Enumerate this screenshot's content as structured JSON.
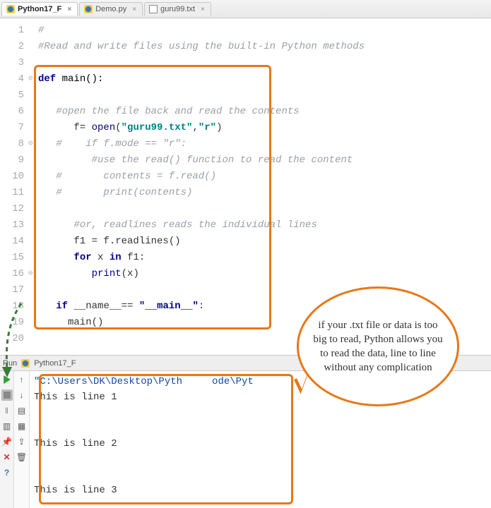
{
  "tabs": [
    {
      "label": "Python17_F",
      "kind": "py",
      "active": true
    },
    {
      "label": "Demo.py",
      "kind": "py",
      "active": false
    },
    {
      "label": "guru99.txt",
      "kind": "txt",
      "active": false
    }
  ],
  "code": {
    "lines": {
      "l1": "#",
      "l2": "#Read and write files using the built-in Python methods",
      "l3": "",
      "l4_def": "def",
      "l4_name": " main():",
      "l5": "",
      "l6": "   #open the file back and read the contents",
      "l7_pre": "      f= ",
      "l7_fn": "open",
      "l7_s1": "\"guru99.txt\"",
      "l7_c": ",",
      "l7_s2": "\"r\"",
      "l7_post": ")",
      "l8": "   #    if f.mode == \"r\":",
      "l9": "         #use the read() function to read the content",
      "l10": "   #       contents = f.read()",
      "l11": "   #       print(contents)",
      "l12": "",
      "l13": "      #or, readlines reads the individual lines",
      "l14": "      f1 = f.readlines()",
      "l15_pre": "      ",
      "l15_for": "for",
      "l15_mid": " x ",
      "l15_in": "in",
      "l15_post": " f1:",
      "l16_pre": "         ",
      "l16_fn": "print",
      "l16_post": "(x)",
      "l17": "",
      "l18_pre": "   ",
      "l18_if": "if",
      "l18_mid": " __name__== ",
      "l18_str": "\"__main__\"",
      "l18_post": ":",
      "l19": "     main()"
    },
    "gutter": "1\n2\n3\n4\n5\n6\n7\n8\n9\n10\n11\n12\n13\n14\n15\n16\n17\n18\n19\n20",
    "fold": "\n\n\n⊖\n\n\n\n⊖\n\n\n\n\n\n\n\n⊖\n\n\n\n"
  },
  "run": {
    "header_label": "Run",
    "config_name": "Python17_F",
    "path_line": "\"C:\\Users\\DK\\Desktop\\Pyth     ode\\Pyt",
    "out1": "This is line 1",
    "out2": "This is line 2",
    "out3": "This is line 3"
  },
  "callout": {
    "text": "if your .txt file or data is too big to read, Python allows you to read the data, line to line without any complication"
  },
  "icons": {
    "run_play": "run-icon",
    "run_stop": "stop-icon",
    "run_pause": "pause-icon",
    "run_restart": "restart-icon",
    "run_up": "up-icon",
    "run_down": "down-icon",
    "run_settings": "settings-icon",
    "run_layout": "layout-icon",
    "run_pin": "pin-icon",
    "run_trash": "trash-icon",
    "run_close": "close-icon",
    "run_help": "help-icon"
  }
}
